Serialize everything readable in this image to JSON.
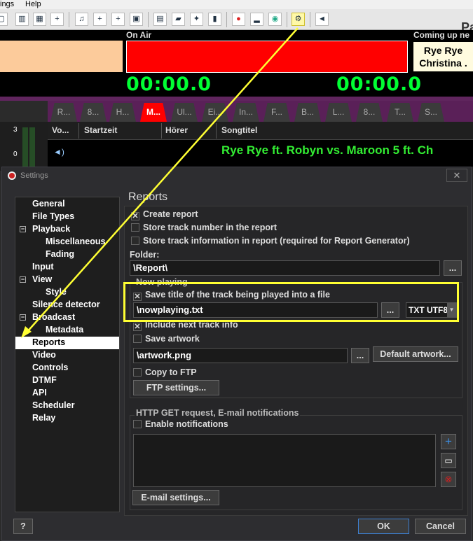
{
  "menubar": {
    "items": [
      "ings",
      "Help"
    ]
  },
  "toolbar": {
    "partial_label": "Pa"
  },
  "deck": {
    "on_air_label": "On Air",
    "timer_elapsed": "00:00.0",
    "timer_remaining": "00:00.0",
    "coming_up_label": "Coming up ne",
    "coming_up_line1": "Rye Rye",
    "coming_up_line2": "Christina ."
  },
  "playlist_tabs": [
    "R...",
    "8...",
    "H...",
    "M...",
    "Ul...",
    "Ei...",
    "In...",
    "F...",
    "B...",
    "L...",
    "8...",
    "T...",
    "S..."
  ],
  "vu": {
    "top": "3",
    "mid": "0"
  },
  "grid": {
    "columns": [
      "Vo...",
      "Startzeit",
      "Hörer",
      "Songtitel"
    ],
    "row_song": "Rye Rye ft. Robyn vs. Maroon 5 ft. Ch"
  },
  "dialog": {
    "title": "Settings",
    "close": "✕",
    "tree": {
      "general": "General",
      "file_types": "File Types",
      "playback": "Playback",
      "misc": "Miscellaneous",
      "fading": "Fading",
      "input": "Input",
      "view": "View",
      "style": "Style",
      "silence": "Silence detector",
      "broadcast": "Broadcast",
      "metadata": "Metadata",
      "reports": "Reports",
      "video": "Video",
      "controls": "Controls",
      "dtmf": "DTMF",
      "api": "API",
      "scheduler": "Scheduler",
      "relay": "Relay"
    },
    "panel_title": "Reports",
    "create_report": "Create report",
    "store_track_number": "Store track number in the report",
    "store_track_info": "Store track information in report (required for Report Generator)",
    "folder_label": "Folder:",
    "folder_value": "\\Report\\",
    "browse": "...",
    "now_playing_label": "Now playing",
    "save_title": "Save title of the track being played into a file",
    "nowplaying_file": "\\nowplaying.txt",
    "format_select": "TXT UTF8",
    "include_next": "Include next track info",
    "save_artwork": "Save artwork",
    "artwork_file": "\\artwork.png",
    "default_artwork": "Default artwork...",
    "copy_ftp": "Copy to FTP",
    "ftp_settings": "FTP settings...",
    "http_label": "HTTP GET request, E-mail notifications",
    "enable_notifications": "Enable notifications",
    "email_settings": "E-mail settings...",
    "help": "?",
    "ok": "OK",
    "cancel": "Cancel"
  },
  "colors": {
    "on_air": "#ff0000",
    "timer": "#00ff33",
    "highlight": "#ffff33",
    "song": "#33ee33"
  }
}
